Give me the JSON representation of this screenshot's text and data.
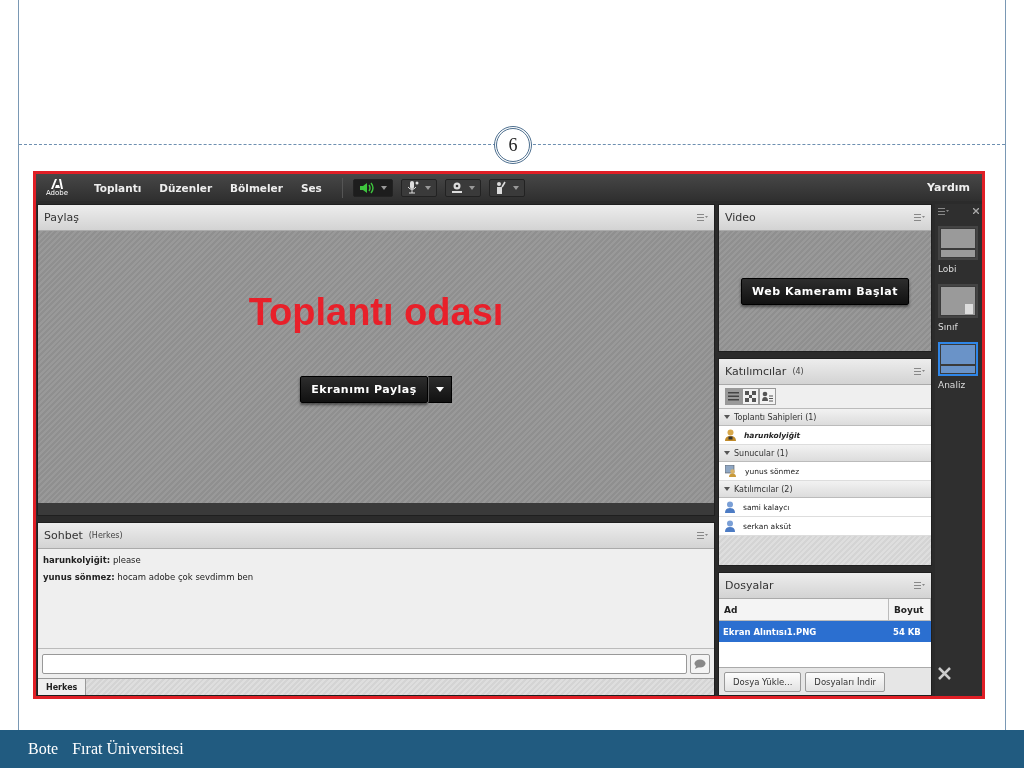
{
  "slide": {
    "number": "6",
    "footer": [
      "Bote",
      "Fırat Üniversitesi"
    ]
  },
  "app": {
    "logo": "Adobe",
    "menus": [
      "Toplantı",
      "Düzenler",
      "Bölmeler",
      "Ses"
    ],
    "toolbar": [
      {
        "kind": "speaker",
        "on": true
      },
      {
        "kind": "microphone",
        "on": false
      },
      {
        "kind": "webcam",
        "on": false
      },
      {
        "kind": "hand",
        "on": false
      }
    ],
    "help": "Yardım"
  },
  "share_pod": {
    "title": "Paylaş",
    "annotation": "Toplantı odası",
    "button": "Ekranımı Paylaş"
  },
  "chat_pod": {
    "title": "Sohbet",
    "scope": "(Herkes)",
    "messages": [
      {
        "author": "harunkolyiğit:",
        "text": "please"
      },
      {
        "author": "yunus sönmez:",
        "text": "hocam adobe çok sevdimm ben"
      }
    ],
    "tabs": [
      {
        "label": "Herkes",
        "selected": true
      }
    ]
  },
  "video_pod": {
    "title": "Video",
    "button": "Web Kameramı Başlat"
  },
  "attendees_pod": {
    "title": "Katılımcılar",
    "count": "(4)",
    "views": [
      {
        "kind": "list",
        "selected": true
      },
      {
        "kind": "grid",
        "selected": false
      },
      {
        "kind": "person",
        "selected": false
      }
    ],
    "groups": [
      {
        "label": "Toplantı Sahipleri (1)",
        "expanded": true,
        "children": [
          {
            "name": "harunkolyiğit",
            "kind": "host"
          }
        ]
      },
      {
        "label": "Sunucular (1)",
        "expanded": true,
        "children": [
          {
            "name": "yunus sönmez",
            "kind": "presenter"
          }
        ]
      },
      {
        "label": "Katılımcılar (2)",
        "expanded": true,
        "children": [
          {
            "name": "sami kalaycı",
            "kind": "participant"
          },
          {
            "name": "serkan aksüt",
            "kind": "participant"
          }
        ]
      }
    ]
  },
  "files_pod": {
    "title": "Dosyalar",
    "columns": [
      "Ad",
      "Boyut"
    ],
    "rows": [
      {
        "cells": [
          "Ekran Alıntısı1.PNG",
          "54 KB"
        ],
        "selected": true
      }
    ],
    "buttons": [
      "Dosya Yükle...",
      "Dosyaları İndir"
    ]
  },
  "layouts": [
    {
      "label": "Lobi",
      "kind": "lobby",
      "selected": false
    },
    {
      "label": "Sınıf",
      "kind": "class",
      "selected": false
    },
    {
      "label": "Analiz",
      "kind": "analysis",
      "selected": true
    }
  ]
}
